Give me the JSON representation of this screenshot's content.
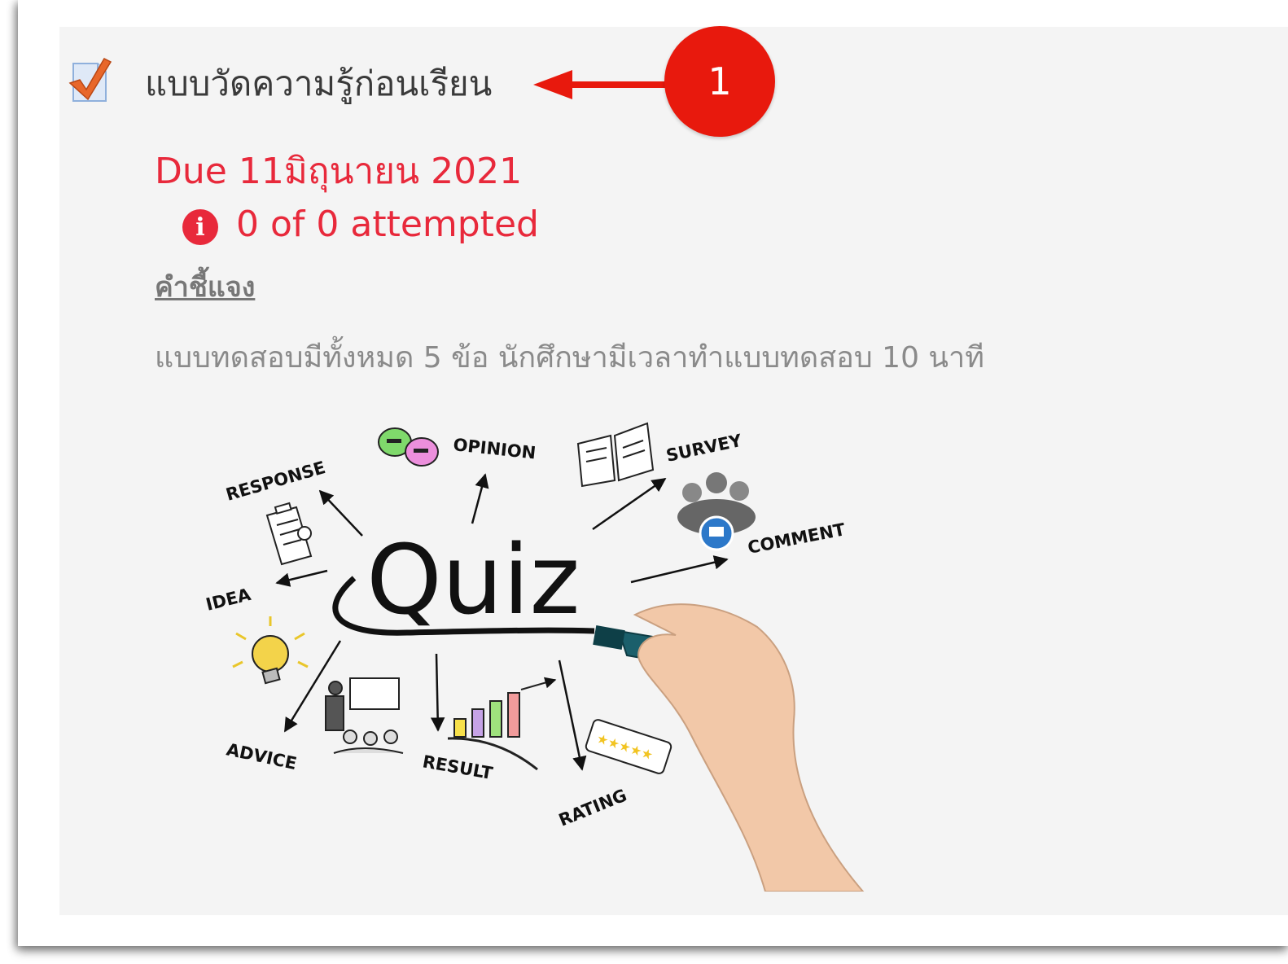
{
  "activity": {
    "icon": "quiz-checkbox-icon",
    "title": "แบบวัดความรู้ก่อนเรียน",
    "annotation_number": "1",
    "due": "Due 11มิถุนายน 2021",
    "attempt_status": "0 of 0 attempted",
    "info_icon_glyph": "i",
    "instructions_link": "คำชี้แจง",
    "description": "แบบทดสอบมีทั้งหมด 5 ข้อ นักศึกษามีเวลาทำแบบทดสอบ 10 นาที"
  },
  "quiz_image": {
    "center_word": "Quiz",
    "labels": {
      "response": "RESPONSE",
      "opinion": "OPINION",
      "survey": "SURVEY",
      "comment": "COMMENT",
      "idea": "IDEA",
      "advice": "ADVICE",
      "result": "RESULT",
      "rating": "RATING"
    }
  },
  "colors": {
    "panel_bg": "#f4f4f4",
    "title_text": "#3a3a3a",
    "due_red": "#e8293b",
    "badge_red": "#e8190d",
    "muted_text": "#8a8a8a"
  }
}
